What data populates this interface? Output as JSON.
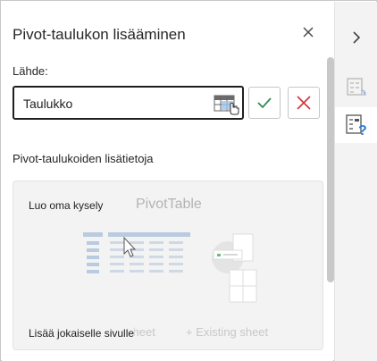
{
  "pane": {
    "title": "Pivot-taulukon lisääminen",
    "close_glyph": "×",
    "source_label": "Lähde:",
    "source_value": "Taulukko",
    "section_label": "Pivot-taulukoiden lisätietoja"
  },
  "card": {
    "create_label": "Luo oma kysely",
    "pivot_label": "PivotTable",
    "ghost_new_sheet": "sheet",
    "ghost_existing_sheet": "+ Existing sheet",
    "add_all_label": "Lisää jokaiselle sivulle"
  },
  "icons": {
    "close": "close-icon",
    "table_select": "table-select-icon",
    "ok": "checkmark-icon",
    "cancel": "x-icon",
    "collapse": "chevron-right-icon",
    "pivot_fields": "pivot-fields-icon",
    "pivot_help": "pivot-help-icon"
  },
  "colors": {
    "ok": "#2e8b57",
    "cancel": "#d13438",
    "accent": "#2b7cd3"
  }
}
